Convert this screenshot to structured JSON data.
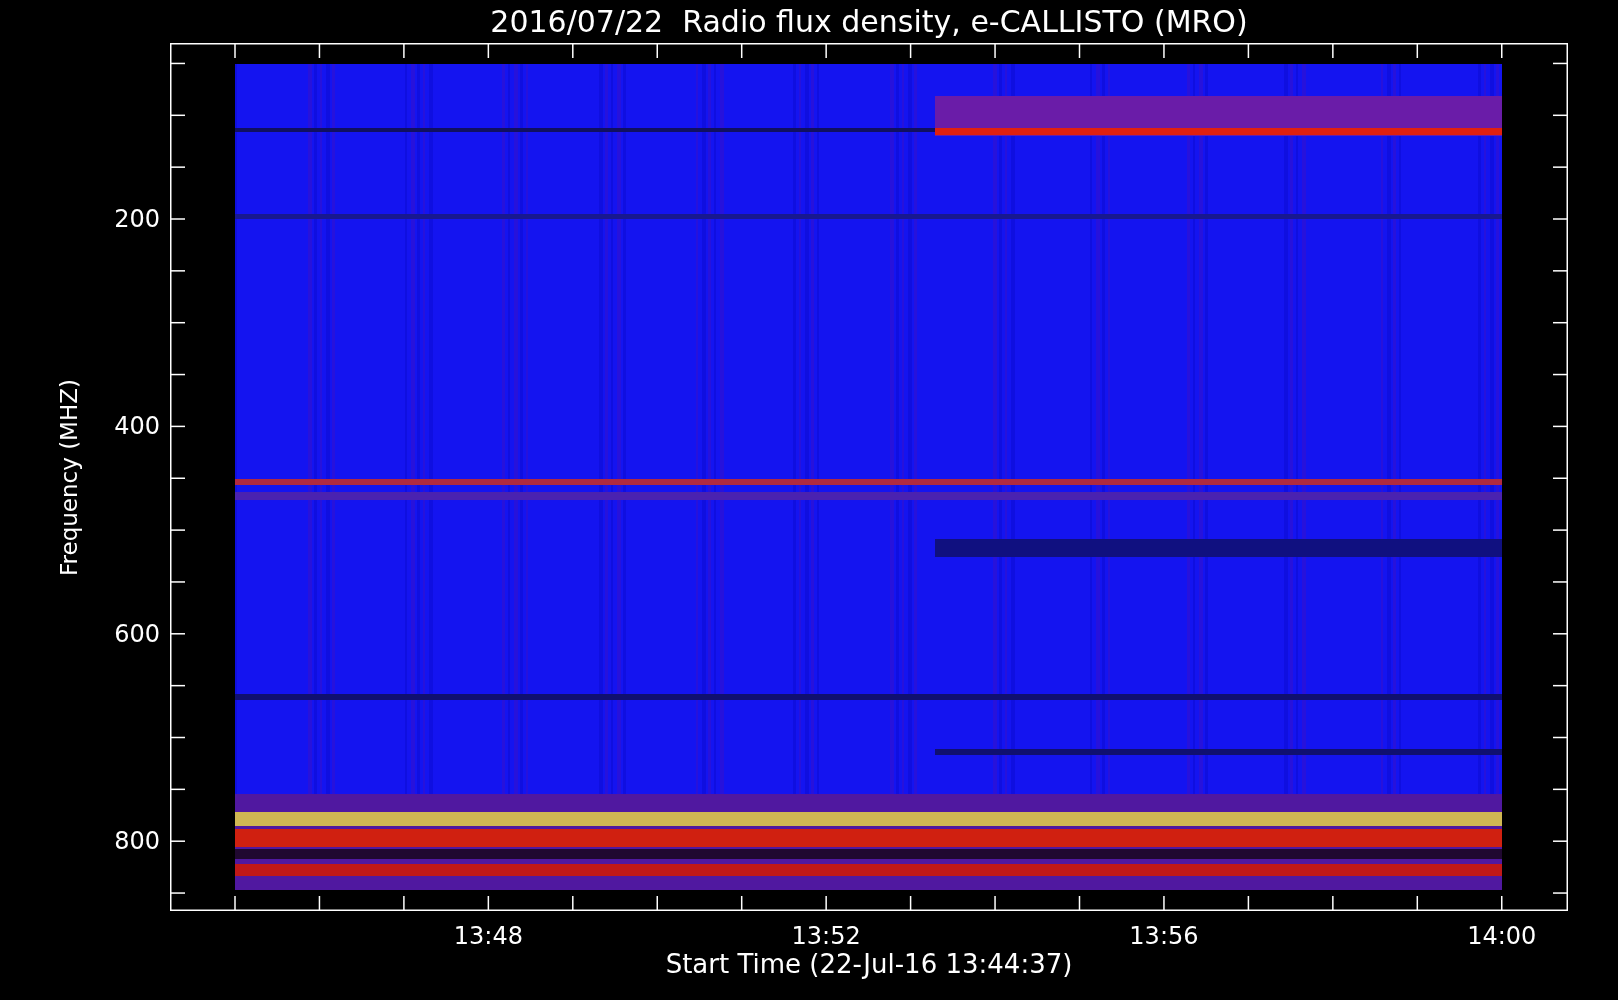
{
  "title": "2016/07/22  Radio flux density, e-CALLISTO (MRO)",
  "ylabel": "Frequency (MHZ)",
  "yticks": [
    "200",
    "400",
    "600",
    "800"
  ],
  "xticks": [
    "13:48",
    "13:52",
    "13:56",
    "14:00"
  ],
  "xlabel": "Start Time (22-Jul-16 13:44:37)"
}
